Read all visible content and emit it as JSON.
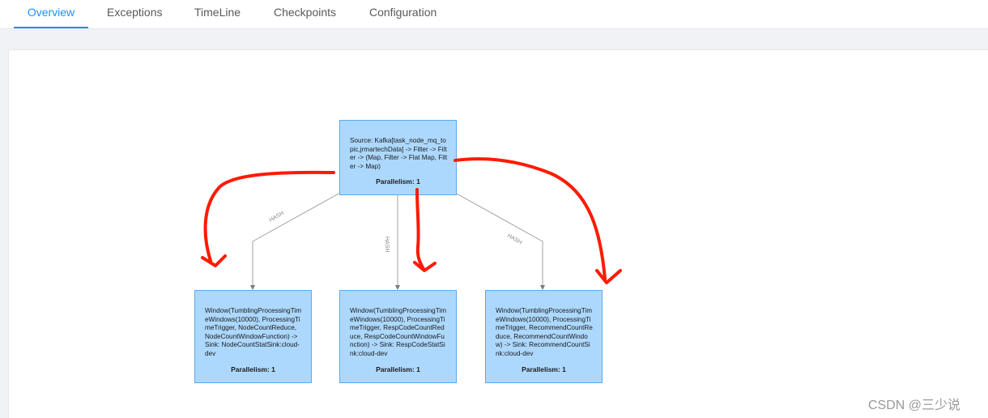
{
  "tabs": [
    {
      "label": "Overview",
      "active": true
    },
    {
      "label": "Exceptions",
      "active": false
    },
    {
      "label": "TimeLine",
      "active": false
    },
    {
      "label": "Checkpoints",
      "active": false
    },
    {
      "label": "Configuration",
      "active": false
    }
  ],
  "graph": {
    "source": {
      "description": "Source: Kafka[task_node_mq_topic,jrmartechData] -> Filter -> Filter -> (Map, Filter -> Flat Map, Filter -> Map)",
      "parallelism": "Parallelism: 1"
    },
    "sinks": [
      {
        "description": "Window(TumblingProcessingTimeWindows(10000), ProcessingTimeTrigger, NodeCountReduce, NodeCountWindowFunction) -> Sink: NodeCountStatSink:cloud-dev",
        "parallelism": "Parallelism: 1"
      },
      {
        "description": "Window(TumblingProcessingTimeWindows(10000), ProcessingTimeTrigger, RespCodeCountReduce, RespCodeCountWindowFunction) -> Sink: RespCodeStatSink:cloud-dev",
        "parallelism": "Parallelism: 1"
      },
      {
        "description": "Window(TumblingProcessingTimeWindows(10000), ProcessingTimeTrigger, RecommendCountReduce, RecommendCountWindow) -> Sink: RecommendCountSink:cloud-dev",
        "parallelism": "Parallelism: 1"
      }
    ],
    "edge_labels": [
      "HASH",
      "HASH",
      "HASH"
    ],
    "colors": {
      "node_fill": "#add8fd",
      "node_border": "#5da9e9",
      "edge": "#a0a0a0",
      "annotation": "#ff1a00",
      "active_tab": "#1890ff"
    }
  },
  "watermark": "CSDN @三少说"
}
